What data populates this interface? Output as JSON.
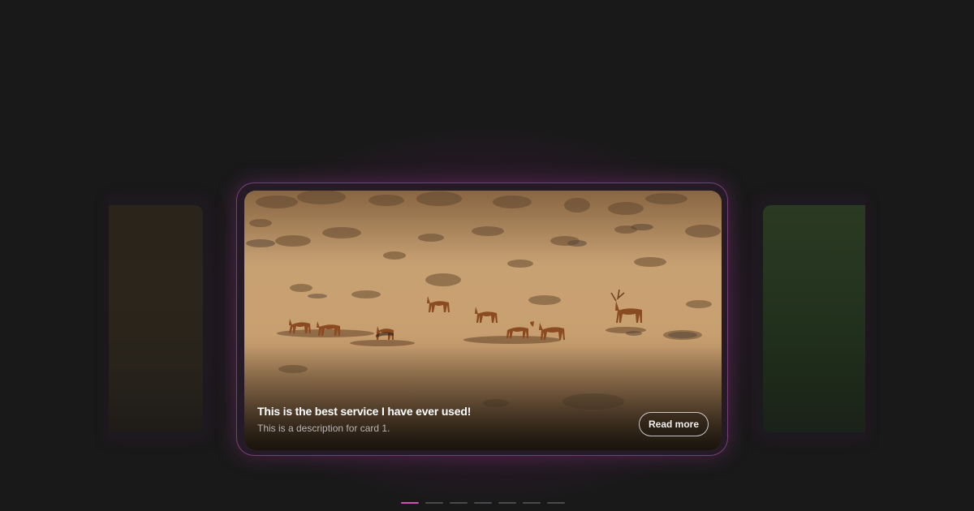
{
  "carousel": {
    "active_index": 0,
    "total_slides": 7,
    "accent_color": "#d24fb5",
    "active_card": {
      "title": "This is the best service I have ever used!",
      "description": "This is a description for card 1.",
      "button_label": "Read more",
      "image": "deer-herd-grassland-image"
    },
    "prev_card": {
      "image": "brown-landscape-image"
    },
    "next_card": {
      "image": "green-field-image"
    }
  }
}
